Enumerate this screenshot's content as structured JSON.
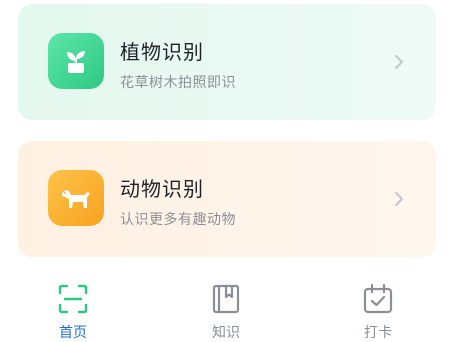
{
  "cards": {
    "plant": {
      "title": "植物识别",
      "subtitle": "花草树木拍照即识",
      "icon": "sprout-pot-icon",
      "accent": "#2dc983"
    },
    "animal": {
      "title": "动物识别",
      "subtitle": "认识更多有趣动物",
      "icon": "dog-icon",
      "accent": "#f7a21f"
    }
  },
  "tabbar": {
    "tabs": [
      {
        "label": "首页",
        "icon": "scan-icon",
        "active": true
      },
      {
        "label": "知识",
        "icon": "book-icon",
        "active": false
      },
      {
        "label": "打卡",
        "icon": "calendar-check-icon",
        "active": false
      }
    ],
    "active_color": "#1f6fe0",
    "inactive_color": "#8a8f96"
  }
}
